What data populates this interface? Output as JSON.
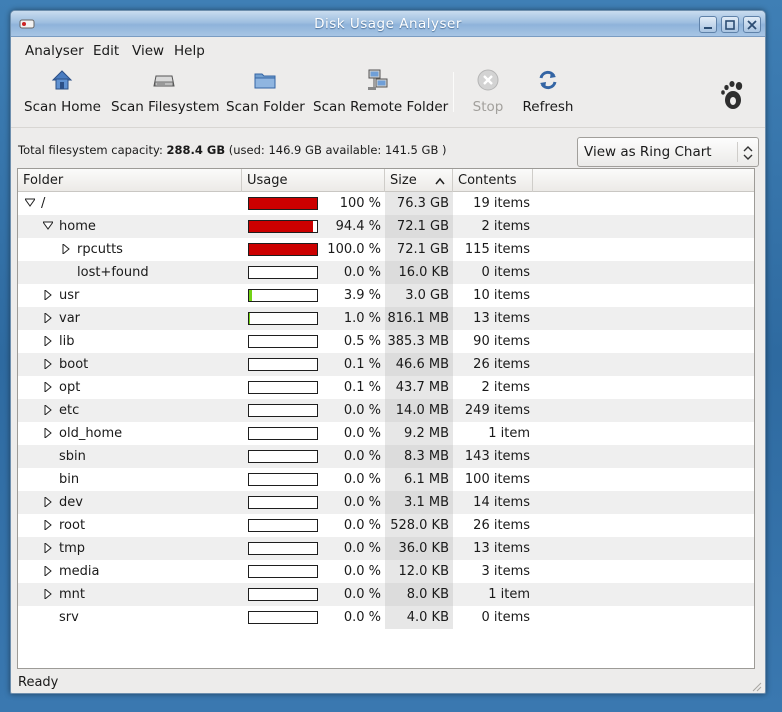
{
  "window": {
    "title": "Disk Usage Analyser"
  },
  "menu": [
    "Analyser",
    "Edit",
    "View",
    "Help"
  ],
  "toolbar": {
    "scan_home": "Scan Home",
    "scan_filesystem": "Scan Filesystem",
    "scan_folder": "Scan Folder",
    "scan_remote": "Scan Remote Folder",
    "stop": "Stop",
    "refresh": "Refresh"
  },
  "info": {
    "capacity_label": "Total filesystem capacity:",
    "capacity_value": "288.4 GB",
    "used_label": "(used:",
    "used_value": "146.9 GB",
    "available_label": "available:",
    "available_value": "141.5 GB )"
  },
  "view_select": {
    "selected": "View as Ring Chart"
  },
  "columns": {
    "folder": "Folder",
    "usage": "Usage",
    "size": "Size",
    "contents": "Contents"
  },
  "rows": [
    {
      "name": "/",
      "level": 0,
      "expander": "down",
      "usage": 100,
      "pct": "100 %",
      "size": "76.3 GB",
      "contents": "19 items"
    },
    {
      "name": "home",
      "level": 1,
      "expander": "down",
      "usage": 94.4,
      "pct": "94.4 %",
      "size": "72.1 GB",
      "contents": "2 items"
    },
    {
      "name": "rpcutts",
      "level": 2,
      "expander": "right",
      "usage": 100,
      "pct": "100.0 %",
      "size": "72.1 GB",
      "contents": "115 items"
    },
    {
      "name": "lost+found",
      "level": 2,
      "expander": "none",
      "usage": 0,
      "pct": "0.0 %",
      "size": "16.0 KB",
      "contents": "0 items"
    },
    {
      "name": "usr",
      "level": 1,
      "expander": "right",
      "usage": 3.9,
      "pct": "3.9 %",
      "size": "3.0 GB",
      "contents": "10 items"
    },
    {
      "name": "var",
      "level": 1,
      "expander": "right",
      "usage": 1.0,
      "pct": "1.0 %",
      "size": "816.1 MB",
      "contents": "13 items"
    },
    {
      "name": "lib",
      "level": 1,
      "expander": "right",
      "usage": 0.5,
      "pct": "0.5 %",
      "size": "385.3 MB",
      "contents": "90 items"
    },
    {
      "name": "boot",
      "level": 1,
      "expander": "right",
      "usage": 0.1,
      "pct": "0.1 %",
      "size": "46.6 MB",
      "contents": "26 items"
    },
    {
      "name": "opt",
      "level": 1,
      "expander": "right",
      "usage": 0.1,
      "pct": "0.1 %",
      "size": "43.7 MB",
      "contents": "2 items"
    },
    {
      "name": "etc",
      "level": 1,
      "expander": "right",
      "usage": 0,
      "pct": "0.0 %",
      "size": "14.0 MB",
      "contents": "249 items"
    },
    {
      "name": "old_home",
      "level": 1,
      "expander": "right",
      "usage": 0,
      "pct": "0.0 %",
      "size": "9.2 MB",
      "contents": "1 item"
    },
    {
      "name": "sbin",
      "level": 1,
      "expander": "none",
      "usage": 0,
      "pct": "0.0 %",
      "size": "8.3 MB",
      "contents": "143 items"
    },
    {
      "name": "bin",
      "level": 1,
      "expander": "none",
      "usage": 0,
      "pct": "0.0 %",
      "size": "6.1 MB",
      "contents": "100 items"
    },
    {
      "name": "dev",
      "level": 1,
      "expander": "right",
      "usage": 0,
      "pct": "0.0 %",
      "size": "3.1 MB",
      "contents": "14 items"
    },
    {
      "name": "root",
      "level": 1,
      "expander": "right",
      "usage": 0,
      "pct": "0.0 %",
      "size": "528.0 KB",
      "contents": "26 items"
    },
    {
      "name": "tmp",
      "level": 1,
      "expander": "right",
      "usage": 0,
      "pct": "0.0 %",
      "size": "36.0 KB",
      "contents": "13 items"
    },
    {
      "name": "media",
      "level": 1,
      "expander": "right",
      "usage": 0,
      "pct": "0.0 %",
      "size": "12.0 KB",
      "contents": "3 items"
    },
    {
      "name": "mnt",
      "level": 1,
      "expander": "right",
      "usage": 0,
      "pct": "0.0 %",
      "size": "8.0 KB",
      "contents": "1 item"
    },
    {
      "name": "srv",
      "level": 1,
      "expander": "none",
      "usage": 0,
      "pct": "0.0 %",
      "size": "4.0 KB",
      "contents": "0 items"
    }
  ],
  "status": "Ready",
  "colors": {
    "bar_high": "#cc0000",
    "bar_low": "#73d216",
    "accent": "#9fbfe0"
  }
}
